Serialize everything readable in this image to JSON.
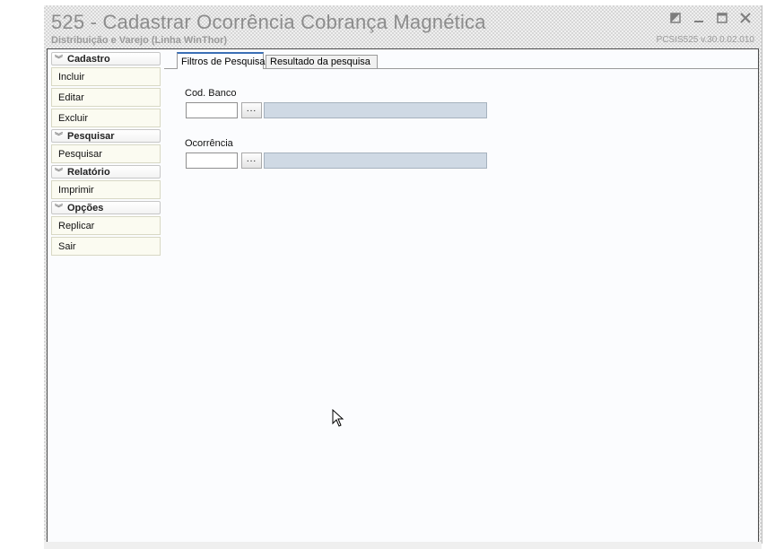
{
  "window": {
    "title": "525 - Cadastrar Ocorrência Cobrança Magnética",
    "subtitle": "Distribuição e Varejo (Linha WinThor)",
    "version": "PCSIS525  v.30.0.02.010",
    "controls": [
      "restore-icon",
      "minimize-icon",
      "maximize-icon",
      "close-icon"
    ]
  },
  "sidebar": {
    "sections": [
      {
        "label": "Cadastro",
        "items": [
          "Incluir",
          "Editar",
          "Excluir"
        ]
      },
      {
        "label": "Pesquisar",
        "items": [
          "Pesquisar"
        ]
      },
      {
        "label": "Relatório",
        "items": [
          "Imprimir"
        ]
      },
      {
        "label": "Opções",
        "items": [
          "Replicar",
          "Sair"
        ]
      }
    ]
  },
  "tabs": [
    {
      "label": "Filtros de Pesquisa",
      "active": true
    },
    {
      "label": "Resultado da pesquisa",
      "active": false
    }
  ],
  "filters": {
    "cod_banco": {
      "label": "Cod. Banco",
      "value": "",
      "button": "..."
    },
    "ocorrencia": {
      "label": "Ocorrência",
      "value": "",
      "button": "..."
    }
  },
  "colors": {
    "tab_accent": "#3a6fb6",
    "description_field": "#cfd9e4",
    "action_bg": "#fbfbf1"
  }
}
